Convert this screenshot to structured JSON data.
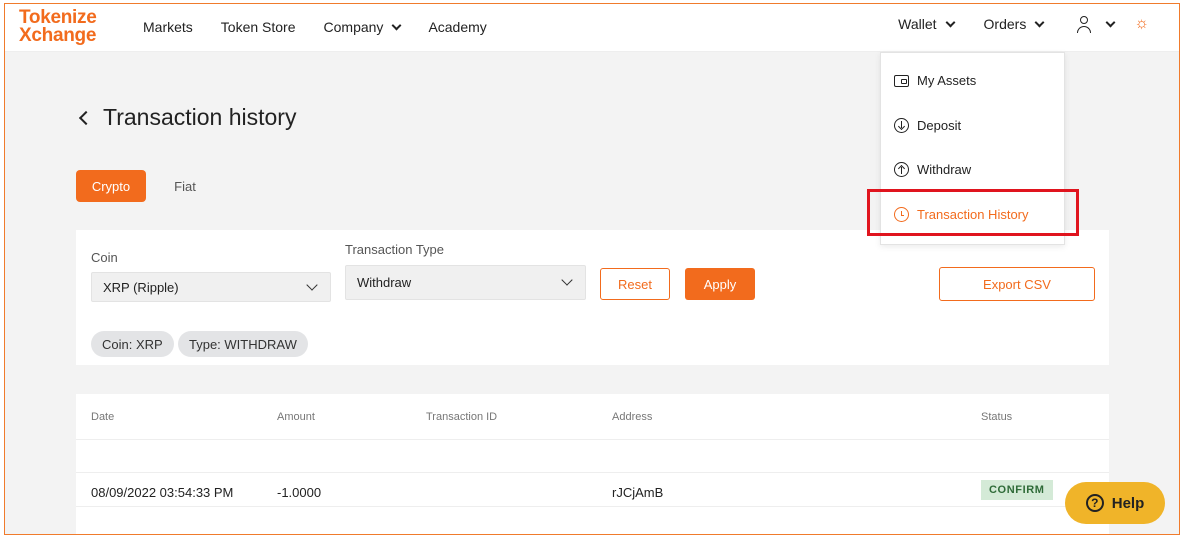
{
  "header": {
    "logo_line1": "Tokenize",
    "logo_line2": "Xchange",
    "nav": [
      "Markets",
      "Token Store",
      "Company",
      "Academy"
    ],
    "wallet_label": "Wallet",
    "orders_label": "Orders",
    "theme_icon": "sun-icon",
    "user_icon": "user-icon"
  },
  "page": {
    "title": "Transaction history",
    "tabs": [
      {
        "label": "Crypto",
        "active": true
      },
      {
        "label": "Fiat",
        "active": false
      }
    ]
  },
  "filters": {
    "coin_label": "Coin",
    "coin_value": "XRP (Ripple)",
    "type_label": "Transaction Type",
    "type_value": "Withdraw",
    "reset_label": "Reset",
    "apply_label": "Apply",
    "export_label": "Export CSV",
    "chips": [
      "Coin: XRP",
      "Type: WITHDRAW"
    ]
  },
  "table": {
    "headers": [
      "Date",
      "Amount",
      "Transaction ID",
      "Address",
      "Status"
    ],
    "rows": [
      {
        "date": "08/09/2022 03:54:33 PM",
        "amount": "-1.0000",
        "transaction_id": "",
        "address": "rJCjAmB",
        "status": "CONFIRM"
      }
    ]
  },
  "wallet_menu": {
    "items": [
      {
        "label": "My Assets",
        "icon": "wallet-icon"
      },
      {
        "label": "Deposit",
        "icon": "arrow-down-circle-icon"
      },
      {
        "label": "Withdraw",
        "icon": "arrow-up-circle-icon"
      },
      {
        "label": "Transaction History",
        "icon": "clock-icon",
        "active": true
      }
    ]
  },
  "help": {
    "label": "Help"
  },
  "colors": {
    "brand": "#f26b1d",
    "highlight": "#e0141e",
    "status_confirm_bg": "#d4ead7",
    "help_bg": "#f0b429"
  }
}
